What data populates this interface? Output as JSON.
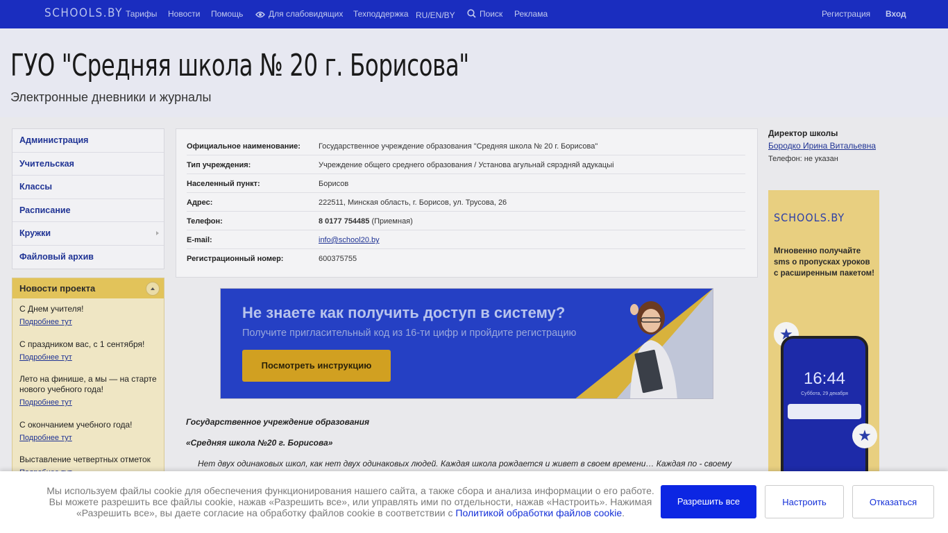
{
  "topbar": {
    "logo": "SCHOOLS.BY",
    "nav": {
      "tariffs": "Тарифы",
      "news": "Новости",
      "help": "Помощь",
      "visually_impaired": "Для слабовидящих",
      "support": "Техподдержка",
      "languages": "RU/EN/BY",
      "search": "Поиск",
      "ads": "Реклама",
      "register": "Регистрация",
      "login": "Вход"
    }
  },
  "header": {
    "title": "ГУО \"Средняя школа № 20 г. Борисова\"",
    "subtitle": "Электронные дневники и журналы"
  },
  "menu": {
    "items": [
      "Администрация",
      "Учительская",
      "Классы",
      "Расписание",
      "Кружки",
      "Файловый архив"
    ]
  },
  "news": {
    "title": "Новости проекта",
    "more_label": "Подробнее тут",
    "items": [
      "С Днем учителя!",
      "С праздником вас, с 1 сентября!",
      "Лето на финише, а мы — на старте нового учебного года!",
      "С окончанием учебного года!",
      "Выставление четвертных отметок"
    ]
  },
  "info": {
    "rows": [
      {
        "label": "Официальное наименование:",
        "value": "Государственное учреждение образования \"Средняя школа № 20 г. Борисова\""
      },
      {
        "label": "Тип учреждения:",
        "value": "Учреждение общего среднего образования / Установа агульнай сярэдняй адукацыі"
      },
      {
        "label": "Населенный пункт:",
        "value": "Борисов"
      },
      {
        "label": "Адрес:",
        "value": "222511, Минская область, г. Борисов, ул. Трусова, 26"
      },
      {
        "label": "Телефон:",
        "value_bold": "8 0177 754485",
        "value": " (Приемная)"
      },
      {
        "label": "E-mail:",
        "value": "info@school20.by"
      },
      {
        "label": "Регистрационный номер:",
        "value": "600375755"
      }
    ]
  },
  "banner": {
    "title": "Не знаете как получить доступ в систему?",
    "subtitle": "Получите пригласительный код из 16-ти цифр и пройдите регистрацию",
    "button": "Посмотреть инструкцию"
  },
  "article": {
    "line1": "Государственное учреждение образования",
    "line2": "«Средняя школа №20 г. Борисова»",
    "line3": "Нет двух одинаковых школ, как нет двух одинаковых людей. Каждая школа рождается и живет в своем времени…  Каждая по - своему"
  },
  "director": {
    "title": "Директор школы",
    "name": "Бородко Ирина Витальевна",
    "phone": "Телефон: не указан"
  },
  "ad": {
    "logo": "SCHOOLS.BY",
    "text": "Мгновенно получайте sms о пропусках уроков с расширенным пакетом!",
    "clock": "16:44",
    "date": "Суббота, 29 декабря"
  },
  "cookie": {
    "text_1": "Мы используем файлы cookie для обеспечения функционирования нашего сайта, а также сбора и анализа информации о его работе. Вы можете разрешить все файлы cookie, нажав «Разрешить все», или управлять ими по отдельности, нажав «Настроить». Нажимая «Разрешить все», вы даете согласие на обработку файлов cookie в соответствии с ",
    "link": "Политикой обработки файлов cookie",
    "text_2": ".",
    "allow": "Разрешить все",
    "setup": "Настроить",
    "deny": "Отказаться"
  }
}
